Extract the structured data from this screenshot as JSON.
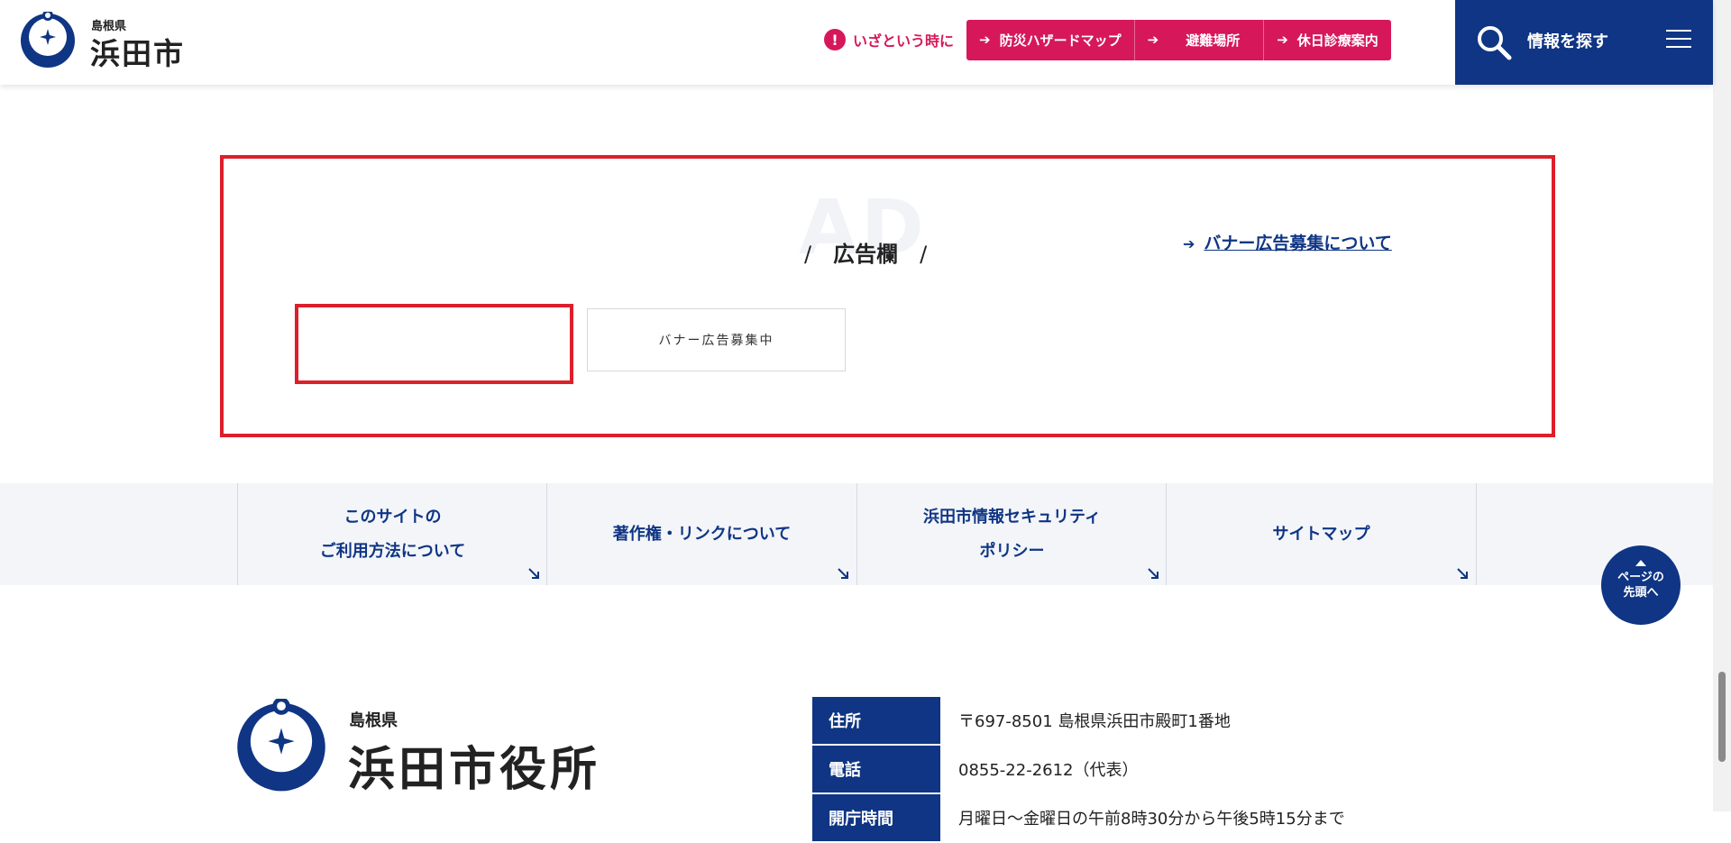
{
  "header": {
    "logo_pref": "島根県",
    "logo_city": "浜田市",
    "emergency_label": "いざという時に",
    "emergency_links": [
      "防災ハザードマップ",
      "避難場所",
      "休日診療案内"
    ],
    "search_label": "情報を探す"
  },
  "ad": {
    "watermark": "AD",
    "title": "広告欄",
    "recruit_link": "バナー広告募集について",
    "banner_placeholder": "バナー広告募集中"
  },
  "footer_nav": [
    {
      "line1": "このサイトの",
      "line2": "ご利用方法について"
    },
    {
      "line1": "著作権・リンクについて",
      "line2": ""
    },
    {
      "line1": "浜田市情報セキュリティ",
      "line2": "ポリシー"
    },
    {
      "line1": "サイトマップ",
      "line2": ""
    }
  ],
  "pagetop": {
    "line1": "ページの",
    "line2": "先頭へ"
  },
  "footer": {
    "logo_pref": "島根県",
    "logo_name": "浜田市役所",
    "rows": [
      {
        "label": "住所",
        "value": "〒697-8501 島根県浜田市殿町1番地"
      },
      {
        "label": "電話",
        "value": "0855-22-2612（代表）"
      },
      {
        "label": "開庁時間",
        "value": "月曜日～金曜日の午前8時30分から午後5時15分まで"
      }
    ]
  },
  "colors": {
    "brand_navy": "#0f3584",
    "emergency_pink": "#d6185a",
    "ad_frame_red": "#dd1f2a"
  }
}
